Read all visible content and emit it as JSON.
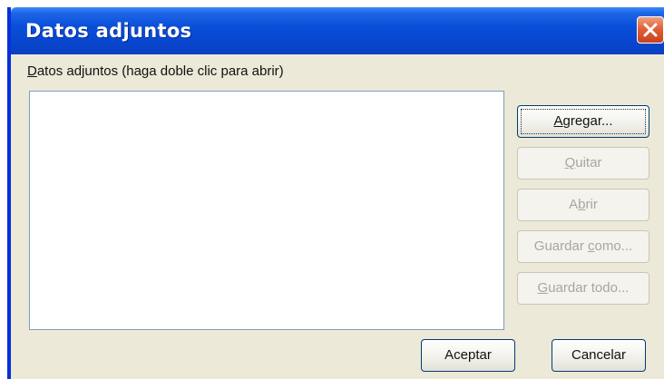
{
  "window": {
    "title": "Datos adjuntos",
    "close_icon": "close-icon"
  },
  "list": {
    "label_accel": "D",
    "label_rest": "atos adjuntos (haga doble clic para abrir)",
    "items": []
  },
  "buttons": {
    "add": {
      "accel": "A",
      "rest": "gregar...",
      "enabled": true,
      "focused": true
    },
    "remove": {
      "accel": "Q",
      "rest": "uitar",
      "enabled": false
    },
    "open": {
      "pre": "A",
      "accel": "b",
      "rest": "rir",
      "enabled": false
    },
    "save_as": {
      "pre": "Guardar ",
      "accel": "c",
      "rest": "omo...",
      "enabled": false
    },
    "save_all": {
      "accel": "G",
      "rest": "uardar todo...",
      "enabled": false
    }
  },
  "footer": {
    "accept_label": "Aceptar",
    "cancel_label": "Cancelar"
  },
  "colors": {
    "titlebar": "#0a4fd8",
    "dialog_bg": "#ece9d8",
    "close_button": "#e0603a"
  }
}
